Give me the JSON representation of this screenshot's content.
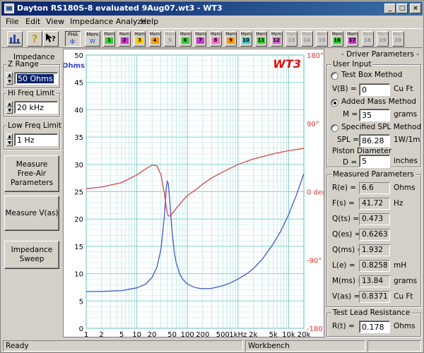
{
  "window": {
    "title": "Dayton RS180S-8 evaluated 9Aug07.wt3 - WT3"
  },
  "title_buttons": {
    "minimize": "_",
    "maximize": "□",
    "close": "×"
  },
  "menu": [
    "File",
    "Edit",
    "View",
    "Impedance Analyzer",
    "Help"
  ],
  "toolbar": {
    "pha_label": "PHA",
    "mem_label": "Mem",
    "mem_w": "W",
    "mem_items": [
      {
        "n": "1",
        "color": "#33cc33",
        "enabled": true
      },
      {
        "n": "2",
        "color": "#cc33cc",
        "enabled": true
      },
      {
        "n": "3",
        "color": "#ffcc00",
        "enabled": true
      },
      {
        "n": "4",
        "color": "#ff9900",
        "enabled": true
      },
      {
        "n": "5",
        "color": "#cccccc",
        "enabled": false
      },
      {
        "n": "6",
        "color": "#33cc33",
        "enabled": true
      },
      {
        "n": "7",
        "color": "#cc33cc",
        "enabled": true
      },
      {
        "n": "8",
        "color": "#ff66cc",
        "enabled": true
      },
      {
        "n": "9",
        "color": "#ff9900",
        "enabled": true
      },
      {
        "n": "10",
        "color": "#33cccc",
        "enabled": true
      },
      {
        "n": "11",
        "color": "#33cc33",
        "enabled": true
      },
      {
        "n": "12",
        "color": "#cc66cc",
        "enabled": true
      },
      {
        "n": "13",
        "color": "#cccccc",
        "enabled": false
      },
      {
        "n": "14",
        "color": "#cccccc",
        "enabled": false
      },
      {
        "n": "15",
        "color": "#cccccc",
        "enabled": false
      },
      {
        "n": "16",
        "color": "#33cc33",
        "enabled": true
      },
      {
        "n": "17",
        "color": "#cc33cc",
        "enabled": true
      },
      {
        "n": "18",
        "color": "#cccccc",
        "enabled": false
      },
      {
        "n": "19",
        "color": "#cccccc",
        "enabled": false
      },
      {
        "n": "20",
        "color": "#cccccc",
        "enabled": false
      }
    ]
  },
  "left": {
    "impedance_title": "Impedance",
    "z_range_label": "Z Range",
    "z_range_value": "50 Ohms",
    "hi_freq_label": "Hi Freq Limit",
    "hi_freq_value": "20 kHz",
    "low_freq_label": "Low Freq Limit",
    "low_freq_value": "1 Hz",
    "btn_free_air": "Measure Free-Air Parameters",
    "btn_vas": "Measure V(as)",
    "btn_sweep": "Impedance Sweep"
  },
  "chart_data": {
    "type": "line",
    "brand": "WT3",
    "y_unit": "Ohms",
    "x_scale": "log",
    "xlim": [
      1,
      20000
    ],
    "ylim": [
      0,
      50
    ],
    "y2lim": [
      -180,
      180
    ],
    "y2_unit": "deg",
    "x_ticks": [
      "1",
      "2",
      "5",
      "10",
      "20",
      "50",
      "100",
      "200",
      "500",
      "1kHz",
      "2k",
      "5k",
      "10k",
      "20k"
    ],
    "y_ticks": [
      "0",
      "5",
      "10",
      "15",
      "20",
      "25",
      "30",
      "35",
      "40",
      "45",
      "50"
    ],
    "y2_ticks": [
      "180°",
      "90°",
      "0 deg",
      "-90°",
      "-180°"
    ],
    "grid": true,
    "series": [
      {
        "color": "#4455cc",
        "axis": "y",
        "x": [
          1,
          2,
          5,
          10,
          15,
          20,
          25,
          30,
          35,
          38,
          40,
          42,
          45,
          48,
          50,
          55,
          60,
          70,
          80,
          100,
          130,
          160,
          200,
          300,
          500,
          700,
          1000,
          1500,
          2000,
          3000,
          5000,
          7000,
          10000,
          14000,
          20000
        ],
        "y": [
          6.7,
          6.75,
          6.9,
          7.4,
          8.1,
          9.3,
          11.2,
          14.5,
          20.5,
          25.5,
          26.9,
          26.5,
          23.0,
          19.5,
          17.5,
          14.0,
          12.0,
          10.0,
          9.0,
          8.1,
          7.6,
          7.35,
          7.25,
          7.3,
          7.8,
          8.3,
          9.0,
          10.0,
          10.9,
          12.6,
          15.5,
          17.8,
          20.8,
          24.2,
          28.3
        ]
      },
      {
        "color": "#dd4444",
        "axis": "y2",
        "x": [
          1,
          2,
          5,
          10,
          15,
          20,
          25,
          30,
          35,
          38,
          40,
          42,
          45,
          50,
          60,
          80,
          100,
          150,
          200,
          300,
          500,
          1000,
          2000,
          5000,
          10000,
          20000
        ],
        "y": [
          4,
          6,
          12,
          22,
          30,
          35,
          34,
          22,
          -2,
          -20,
          -28,
          -32,
          -32,
          -29,
          -22,
          -12,
          -5,
          3,
          10,
          18,
          26,
          36,
          43,
          50,
          54,
          57
        ]
      }
    ]
  },
  "right": {
    "title": "Driver Parameters",
    "user_input_label": "User Input",
    "test_box_label": "Test Box Method",
    "vb_label": "V(B) =",
    "vb_value": "0",
    "vb_unit": "Cu Ft",
    "added_mass_label": "Added Mass Method",
    "m_label": "M =",
    "m_value": "35",
    "m_unit": "grams",
    "spl_method_label": "Specified SPL Method",
    "spl_label": "SPL =",
    "spl_value": "86.28",
    "spl_unit": "1W/1m",
    "piston_label": "Piston Diameter",
    "d_label": "D =",
    "d_value": "5",
    "d_unit": "inches",
    "measured_label": "Measured Parameters",
    "params": [
      {
        "label": "R(e) =",
        "value": "6.6",
        "unit": "Ohms"
      },
      {
        "label": "F(s) =",
        "value": "41.72",
        "unit": "Hz"
      },
      {
        "label": "Q(ts) =",
        "value": "0.473",
        "unit": ""
      },
      {
        "label": "Q(es) =",
        "value": "0.6263",
        "unit": ""
      },
      {
        "label": "Q(ms) =",
        "value": "1.932",
        "unit": ""
      },
      {
        "label": "L(e) =",
        "value": "0.8258",
        "unit": "mH"
      },
      {
        "label": "M(ms) =",
        "value": "13.84",
        "unit": "grams"
      },
      {
        "label": "V(as) =",
        "value": "0.8371",
        "unit": "Cu Ft"
      }
    ],
    "lead_label": "Test Lead Resistance",
    "rt_label": "R(t) =",
    "rt_value": "0.178",
    "rt_unit": "Ohms"
  },
  "status": {
    "left": "Ready",
    "mid": "Workbench"
  }
}
